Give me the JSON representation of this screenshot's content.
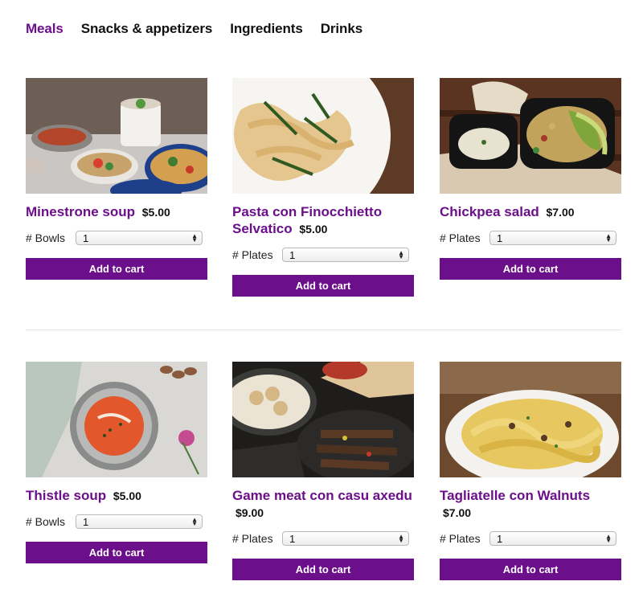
{
  "tabs": [
    {
      "label": "Meals"
    },
    {
      "label": "Snacks & appetizers"
    },
    {
      "label": "Ingredients"
    },
    {
      "label": "Drinks"
    }
  ],
  "colors": {
    "accent": "#6b0f8a"
  },
  "products": [
    {
      "name": "Minestrone soup",
      "price": "$5.00",
      "qty_label": "# Bowls",
      "qty_value": "1",
      "button": "Add to cart",
      "image": "minestrone-image"
    },
    {
      "name": "Pasta con Finocchietto Selvatico",
      "price": "$5.00",
      "qty_label": "# Plates",
      "qty_value": "1",
      "button": "Add to cart",
      "image": "pasta-image"
    },
    {
      "name": "Chickpea salad",
      "price": "$7.00",
      "qty_label": "# Plates",
      "qty_value": "1",
      "button": "Add to cart",
      "image": "chickpea-image"
    },
    {
      "name": "Thistle soup",
      "price": "$5.00",
      "qty_label": "# Bowls",
      "qty_value": "1",
      "button": "Add to cart",
      "image": "thistle-soup-image"
    },
    {
      "name": "Game meat con casu axedu",
      "price": "$9.00",
      "qty_label": "# Plates",
      "qty_value": "1",
      "button": "Add to cart",
      "image": "game-meat-image"
    },
    {
      "name": "Tagliatelle con Walnuts",
      "price": "$7.00",
      "qty_label": "# Plates",
      "qty_value": "1",
      "button": "Add to cart",
      "image": "tagliatelle-image"
    }
  ]
}
